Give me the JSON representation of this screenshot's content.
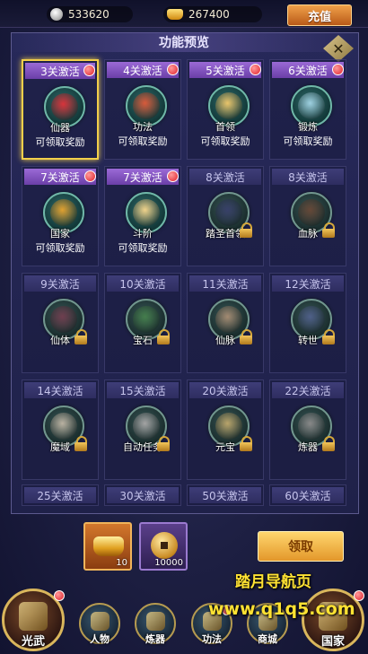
{
  "top_bar": {
    "silver": "533620",
    "gold": "267400",
    "recharge_label": "充值"
  },
  "panel": {
    "title": "功能预览",
    "claim_text": "可领取奖励"
  },
  "features": [
    {
      "unlock": "3关激活",
      "name": "仙器",
      "active": true,
      "claimable": true,
      "locked": false,
      "selected": true,
      "color": "#d8333a"
    },
    {
      "unlock": "4关激活",
      "name": "功法",
      "active": true,
      "claimable": true,
      "locked": false,
      "selected": false,
      "color": "#d85a3a"
    },
    {
      "unlock": "5关激活",
      "name": "首领",
      "active": true,
      "claimable": true,
      "locked": false,
      "selected": false,
      "color": "#e9c46a"
    },
    {
      "unlock": "6关激活",
      "name": "锻炼",
      "active": true,
      "claimable": true,
      "locked": false,
      "selected": false,
      "color": "#9ed0e0"
    },
    {
      "unlock": "7关激活",
      "name": "国家",
      "active": true,
      "claimable": true,
      "locked": false,
      "selected": false,
      "color": "#e0a030"
    },
    {
      "unlock": "7关激活",
      "name": "斗阶",
      "active": true,
      "claimable": true,
      "locked": false,
      "selected": false,
      "color": "#f0d28a"
    },
    {
      "unlock": "8关激活",
      "name": "踏圣首领",
      "active": false,
      "claimable": false,
      "locked": true,
      "selected": false,
      "color": "#3a4a9a"
    },
    {
      "unlock": "8关激活",
      "name": "血脉",
      "active": false,
      "claimable": false,
      "locked": true,
      "selected": false,
      "color": "#8a5030"
    },
    {
      "unlock": "9关激活",
      "name": "仙体",
      "active": false,
      "claimable": false,
      "locked": true,
      "selected": false,
      "color": "#a04060"
    },
    {
      "unlock": "10关激活",
      "name": "宝石",
      "active": false,
      "claimable": false,
      "locked": true,
      "selected": false,
      "color": "#30a040"
    },
    {
      "unlock": "11关激活",
      "name": "仙脉",
      "active": false,
      "claimable": false,
      "locked": true,
      "selected": false,
      "color": "#d0a070"
    },
    {
      "unlock": "12关激活",
      "name": "转世",
      "active": false,
      "claimable": false,
      "locked": true,
      "selected": false,
      "color": "#5070c0"
    },
    {
      "unlock": "14关激活",
      "name": "魔域",
      "active": false,
      "claimable": false,
      "locked": true,
      "selected": false,
      "color": "#e0d0b0"
    },
    {
      "unlock": "15关激活",
      "name": "自动任务",
      "active": false,
      "claimable": false,
      "locked": true,
      "selected": false,
      "color": "#c0c0c0"
    },
    {
      "unlock": "20关激活",
      "name": "元宝",
      "active": false,
      "claimable": false,
      "locked": true,
      "selected": false,
      "color": "#e8c050"
    },
    {
      "unlock": "22关激活",
      "name": "炼器",
      "active": false,
      "claimable": false,
      "locked": true,
      "selected": false,
      "color": "#a0a0a0"
    },
    {
      "unlock": "25关激活",
      "name": "",
      "active": false,
      "claimable": false,
      "locked": false,
      "selected": false,
      "color": "",
      "partial": true
    },
    {
      "unlock": "30关激活",
      "name": "",
      "active": false,
      "claimable": false,
      "locked": false,
      "selected": false,
      "color": "",
      "partial": true
    },
    {
      "unlock": "50关激活",
      "name": "",
      "active": false,
      "claimable": false,
      "locked": false,
      "selected": false,
      "color": "",
      "partial": true
    },
    {
      "unlock": "60关激活",
      "name": "",
      "active": false,
      "claimable": false,
      "locked": false,
      "selected": false,
      "color": "",
      "partial": true
    }
  ],
  "rewards": {
    "gold_qty": "10",
    "coin_qty": "10000",
    "claim_button": "领取"
  },
  "watermark": {
    "line1": "踏月导航页",
    "line2": "www.q1q5.com"
  },
  "nav": {
    "items": [
      {
        "label": "光武",
        "icon": "sword-emblem-icon",
        "badge": true
      },
      {
        "label": "人物",
        "icon": "helmet-icon",
        "badge": false
      },
      {
        "label": "炼器",
        "icon": "armor-icon",
        "badge": false
      },
      {
        "label": "功法",
        "icon": "scroll-icon",
        "badge": true
      },
      {
        "label": "商城",
        "icon": "shop-icon",
        "badge": false
      },
      {
        "label": "国家",
        "icon": "castle-icon",
        "badge": true
      }
    ]
  }
}
